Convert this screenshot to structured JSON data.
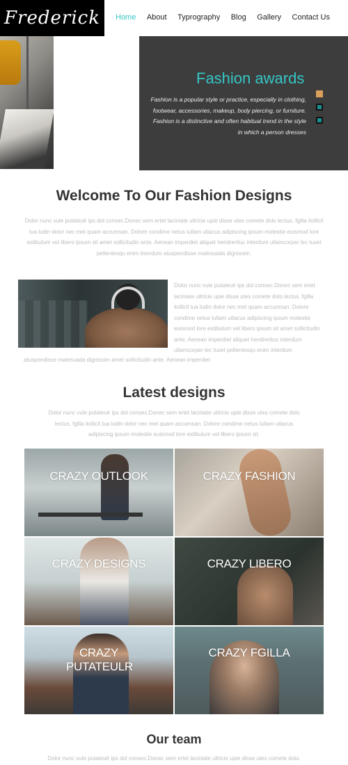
{
  "header": {
    "logo": "Frederick",
    "nav": [
      "Home",
      "About",
      "Typrography",
      "Blog",
      "Gallery",
      "Contact Us"
    ]
  },
  "hero": {
    "title": "Fashion awards",
    "text": "Fashion is a popular style or practice, especially in clothing, footwear, accessories, makeup, body piercing, or furniture. Fashion is a distinctive and often habitual trend in the style in which a person dresses"
  },
  "welcome": {
    "title": "Welcome To Our Fashion Designs",
    "text": "Dolor nunc vule putateulr ips dol consec.Donec sem ertet laciniate ultricie upie disse utes comete dolo lectus. fgilla itollicil tua ludin dolor nec met quam accumsan. Dolore condime netus lullam utlacus adipiscing ipsum molestie euismod lore estibulum vel libero ipsum sit amet sollicitudin ante. Aenean imperdiet aliquet hendrerituc interdum ullamcorper lec tuset pellentesqu enim interdum atuspendisse malesuada dignissim."
  },
  "about": {
    "text": "Dolor nunc vule putateulr ips dol consec.Donec sem ertet laciniate ultricie upie disse utes comete dolo lectus. fgilla itollicil tua ludin dolor nec met quam accumsan. Dolore condime netus lullam utlacus adipiscing ipsum molestie euismod lore estibulum vel libero ipsum sit amet sollicitudin ante. Aenean imperdiet aliquet hendrerituc interdum ullamcorper lec tuset pellentesqu enim interdum",
    "tail": "atuspendisse malesuada dignissim amet sollicitudin ante. Aenean imperdiet"
  },
  "latest": {
    "title": "Latest designs",
    "text": "Dolor nunc vule putateulr ips dol consec.Donec sem ertet laciniate ultricie upie disse utes comete dolo lectus. fgilla itollicil tua ludin dolor nec met quam accumsan. Dolore condime netus lullam utlacus adipiscing ipsum molestie euismod lore estibulum vel libero ipsum sit.",
    "tiles": [
      "CRAZY OUTLOOK",
      "CRAZY FASHION",
      "CRAZY DESIGNS",
      "CRAZY LIBERO",
      "CRAZY PUTATEULR",
      "CRAZY FGILLA"
    ]
  },
  "team": {
    "title": "Our team",
    "text": "Dolor nunc vule putateulr ips dol consec.Donec sem ertet laciniate ultricie upie disse utes comete dolo."
  },
  "colors": {
    "accent": "#34c6c6",
    "dark_panel": "#3d3d3d",
    "slider_active": "#d9a15a"
  }
}
